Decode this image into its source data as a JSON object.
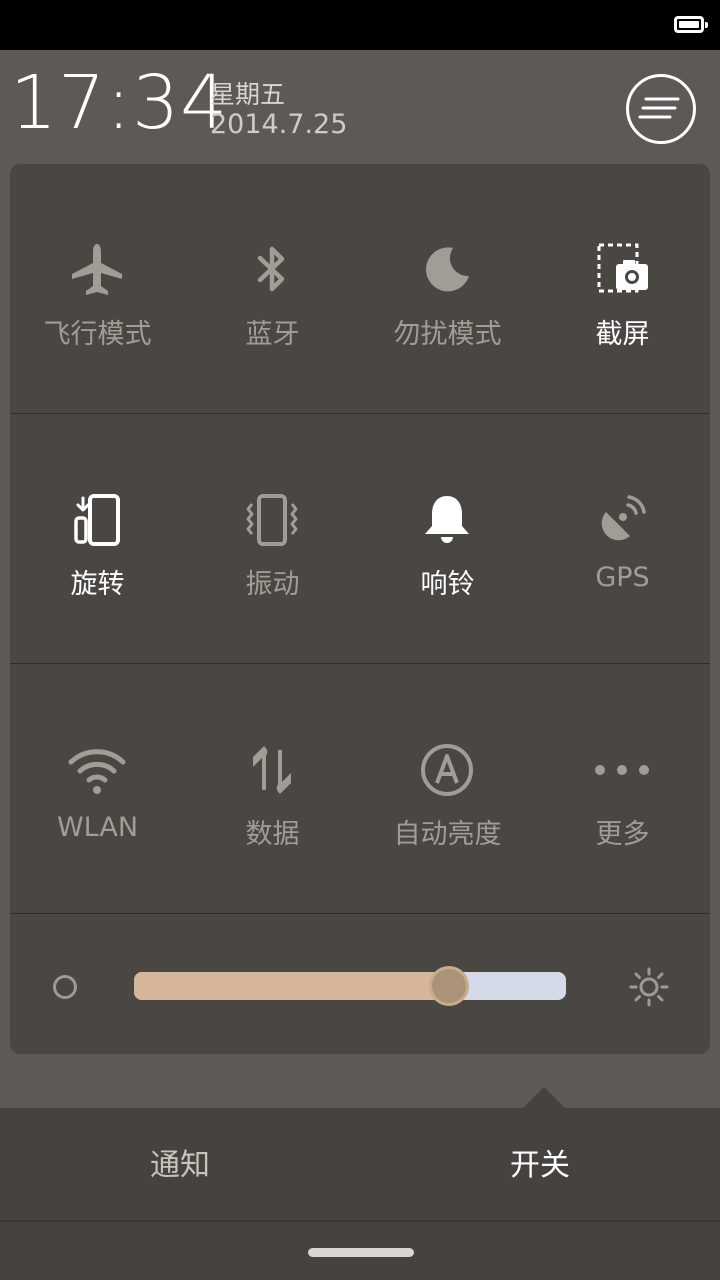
{
  "header": {
    "time": "17:34",
    "weekday": "星期五",
    "date": "2014.7.25"
  },
  "toggles": [
    {
      "label": "飞行模式",
      "icon": "airplane-icon",
      "state": "off"
    },
    {
      "label": "蓝牙",
      "icon": "bluetooth-icon",
      "state": "off"
    },
    {
      "label": "勿扰模式",
      "icon": "moon-icon",
      "state": "off"
    },
    {
      "label": "截屏",
      "icon": "screenshot-icon",
      "state": "on"
    },
    {
      "label": "旋转",
      "icon": "rotate-icon",
      "state": "on"
    },
    {
      "label": "振动",
      "icon": "vibrate-icon",
      "state": "off"
    },
    {
      "label": "响铃",
      "icon": "bell-icon",
      "state": "on"
    },
    {
      "label": "GPS",
      "icon": "gps-icon",
      "state": "off"
    },
    {
      "label": "WLAN",
      "icon": "wifi-icon",
      "state": "off"
    },
    {
      "label": "数据",
      "icon": "data-icon",
      "state": "off"
    },
    {
      "label": "自动亮度",
      "icon": "auto-brightness-icon",
      "state": "off"
    },
    {
      "label": "更多",
      "icon": "more-icon",
      "state": "off"
    }
  ],
  "brightness": {
    "level": 0.73
  },
  "tabs": {
    "notifications": "通知",
    "toggles": "开关"
  },
  "colors": {
    "on": "#ffffff",
    "off": "#a09c96",
    "slider_fill": "#d6b598",
    "slider_track": "#d4dbe8"
  }
}
